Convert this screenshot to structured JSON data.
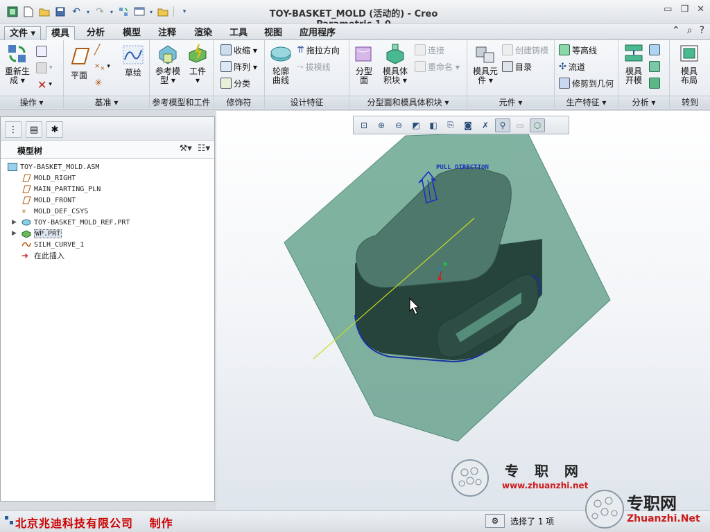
{
  "window": {
    "title": "TOY-BASKET_MOLD (活动的) - Creo Parametric 1.0"
  },
  "menubar": {
    "tabs": [
      {
        "label": "文件 ▾"
      },
      {
        "label": "模具"
      },
      {
        "label": "分析"
      },
      {
        "label": "模型"
      },
      {
        "label": "注释"
      },
      {
        "label": "渲染"
      },
      {
        "label": "工具"
      },
      {
        "label": "视图"
      },
      {
        "label": "应用程序"
      }
    ]
  },
  "ribbon": {
    "groups": [
      {
        "label": "操作 ▾"
      },
      {
        "label": "基准 ▾"
      },
      {
        "label": "参考模型和工件"
      },
      {
        "label": "修饰符"
      },
      {
        "label": "设计特征"
      },
      {
        "label": "分型面和模具体积块 ▾"
      },
      {
        "label": "元件 ▾"
      },
      {
        "label": "生产特征 ▾"
      },
      {
        "label": "分析 ▾"
      },
      {
        "label": "转到"
      }
    ],
    "regenerate": {
      "line1": "重新生",
      "line2": "成 ▾"
    },
    "plane": "平面",
    "sketch": "草绘",
    "ref_model": {
      "line1": "参考模",
      "line2": "型 ▾"
    },
    "workpiece": {
      "line1": "工件",
      "line2": "▾"
    },
    "shrink": "收缩 ▾",
    "pattern": "阵列 ▾",
    "classify": "分类",
    "silhouette": {
      "line1": "轮廓",
      "line2": "曲线"
    },
    "pull_direction": "拖拉方向",
    "draft_line": "拔模线",
    "parting_surface": {
      "line1": "分型",
      "line2": "面"
    },
    "mold_volume": {
      "line1": "模具体",
      "line2": "积块 ▾"
    },
    "connect": "连接",
    "rename": "重命名 ▾",
    "mold_component": {
      "line1": "模具元",
      "line2": "件 ▾"
    },
    "create_casting": "创建铸模",
    "catalog": "目录",
    "contour": "等高线",
    "runner": "流道",
    "trim_to_geometry": "修剪到几何",
    "mold_open": {
      "line1": "模具",
      "line2": "开模"
    },
    "mold_layout": {
      "line1": "模具",
      "line2": "布局"
    }
  },
  "left_panel": {
    "tree_title": "模型树",
    "nodes": [
      {
        "label": "TOY-BASKET_MOLD.ASM",
        "icon": "assembly-icon"
      },
      {
        "label": "MOLD_RIGHT",
        "icon": "datum-plane-icon"
      },
      {
        "label": "MAIN_PARTING_PLN",
        "icon": "datum-plane-icon"
      },
      {
        "label": "MOLD_FRONT",
        "icon": "datum-plane-icon"
      },
      {
        "label": "MOLD_DEF_CSYS",
        "icon": "csys-icon"
      },
      {
        "label": "TOY-BASKET_MOLD_REF.PRT",
        "icon": "part-icon"
      },
      {
        "label": "WP.PRT",
        "icon": "workpiece-icon"
      },
      {
        "label": "SILH_CURVE_1",
        "icon": "curve-icon"
      },
      {
        "label": "在此插入",
        "icon": "insert-arrow-icon"
      }
    ]
  },
  "viewport": {
    "pull_direction_label": "PULL DIRECTION"
  },
  "status": {
    "brand": "北京兆迪科技有限公司　 制作",
    "selection": "选择了 1 项"
  },
  "watermark": {
    "cn": "专 职 网",
    "url": "www.zhuanzhi.net",
    "cn2": "专职网",
    "url2": "Zhuanzhi.Net"
  },
  "colors": {
    "block_fill": "#5f9c87",
    "part_dark": "#27443c",
    "brand_red": "#cc0000"
  }
}
